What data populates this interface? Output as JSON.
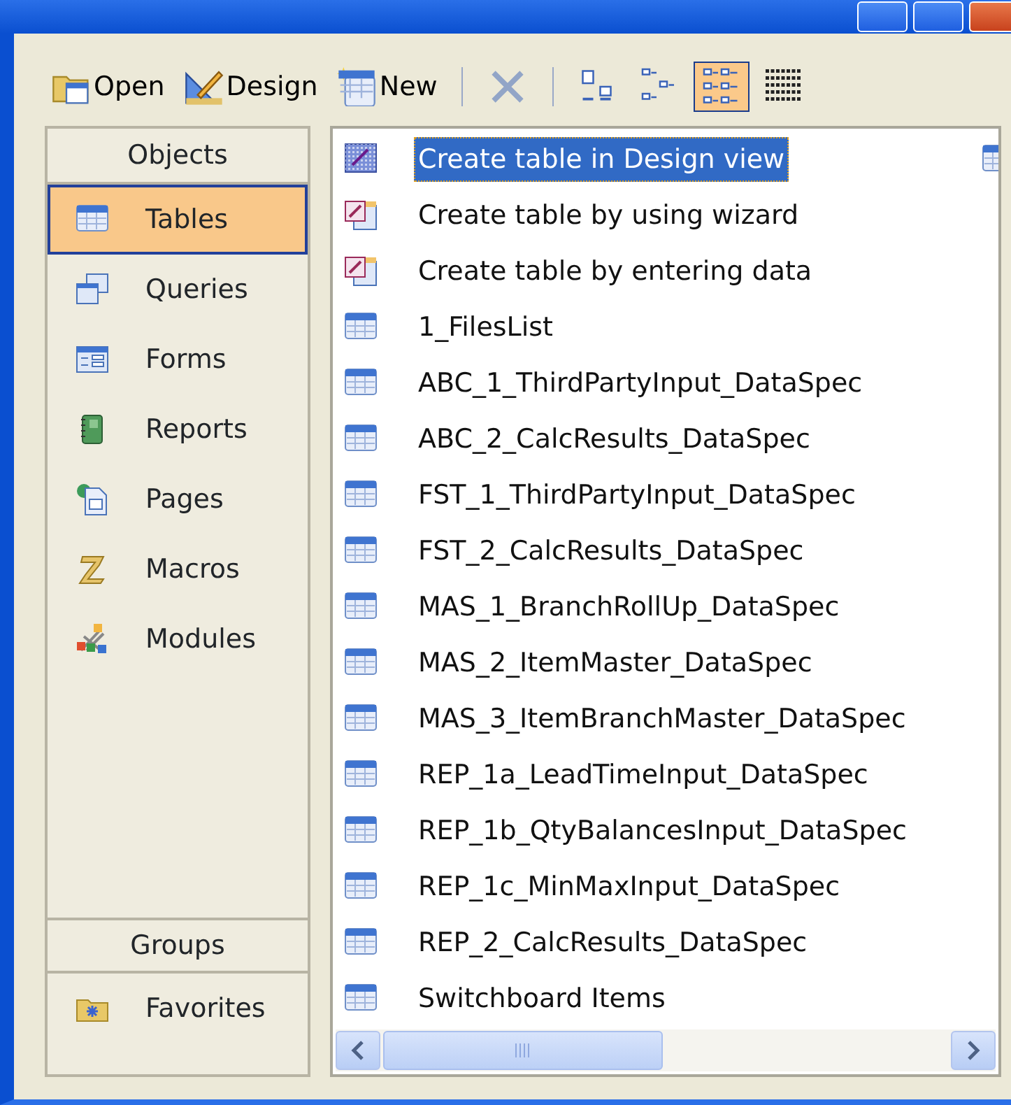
{
  "toolbar": [
    {
      "kind": "open",
      "label": "Open"
    },
    {
      "kind": "design",
      "label": "Design"
    },
    {
      "kind": "new",
      "label": "New"
    },
    {
      "kind": "separator"
    },
    {
      "kind": "delete",
      "disabled": true
    },
    {
      "kind": "separator"
    },
    {
      "kind": "large_icons",
      "selected": false
    },
    {
      "kind": "small_icons",
      "selected": false
    },
    {
      "kind": "list",
      "selected": true
    },
    {
      "kind": "details",
      "selected": false
    }
  ],
  "sidebar": {
    "objects_header": "Objects",
    "objects": [
      {
        "kind": "tables",
        "label": "Tables",
        "selected": true
      },
      {
        "kind": "queries",
        "label": "Queries",
        "selected": false
      },
      {
        "kind": "forms",
        "label": "Forms",
        "selected": false
      },
      {
        "kind": "reports",
        "label": "Reports",
        "selected": false
      },
      {
        "kind": "pages",
        "label": "Pages",
        "selected": false
      },
      {
        "kind": "macros",
        "label": "Macros",
        "selected": false
      },
      {
        "kind": "modules",
        "label": "Modules",
        "selected": false
      }
    ],
    "groups_header": "Groups",
    "groups": [
      {
        "kind": "favorites",
        "label": "Favorites"
      }
    ]
  },
  "list": {
    "items": [
      {
        "kind": "design",
        "label": "Create table in Design view",
        "selected": true
      },
      {
        "kind": "wizard",
        "label": "Create table by using wizard",
        "selected": false
      },
      {
        "kind": "wizard",
        "label": "Create table by entering data",
        "selected": false
      },
      {
        "kind": "table",
        "label": "1_FilesList",
        "selected": false
      },
      {
        "kind": "table",
        "label": "ABC_1_ThirdPartyInput_DataSpec",
        "selected": false
      },
      {
        "kind": "table",
        "label": "ABC_2_CalcResults_DataSpec",
        "selected": false
      },
      {
        "kind": "table",
        "label": "FST_1_ThirdPartyInput_DataSpec",
        "selected": false
      },
      {
        "kind": "table",
        "label": "FST_2_CalcResults_DataSpec",
        "selected": false
      },
      {
        "kind": "table",
        "label": "MAS_1_BranchRollUp_DataSpec",
        "selected": false
      },
      {
        "kind": "table",
        "label": "MAS_2_ItemMaster_DataSpec",
        "selected": false
      },
      {
        "kind": "table",
        "label": "MAS_3_ItemBranchMaster_DataSpec",
        "selected": false
      },
      {
        "kind": "table",
        "label": "REP_1a_LeadTimeInput_DataSpec",
        "selected": false
      },
      {
        "kind": "table",
        "label": "REP_1b_QtyBalancesInput_DataSpec",
        "selected": false
      },
      {
        "kind": "table",
        "label": "REP_1c_MinMaxInput_DataSpec",
        "selected": false
      },
      {
        "kind": "table",
        "label": "REP_2_CalcResults_DataSpec",
        "selected": false
      },
      {
        "kind": "table",
        "label": "Switchboard Items",
        "selected": false
      }
    ]
  }
}
